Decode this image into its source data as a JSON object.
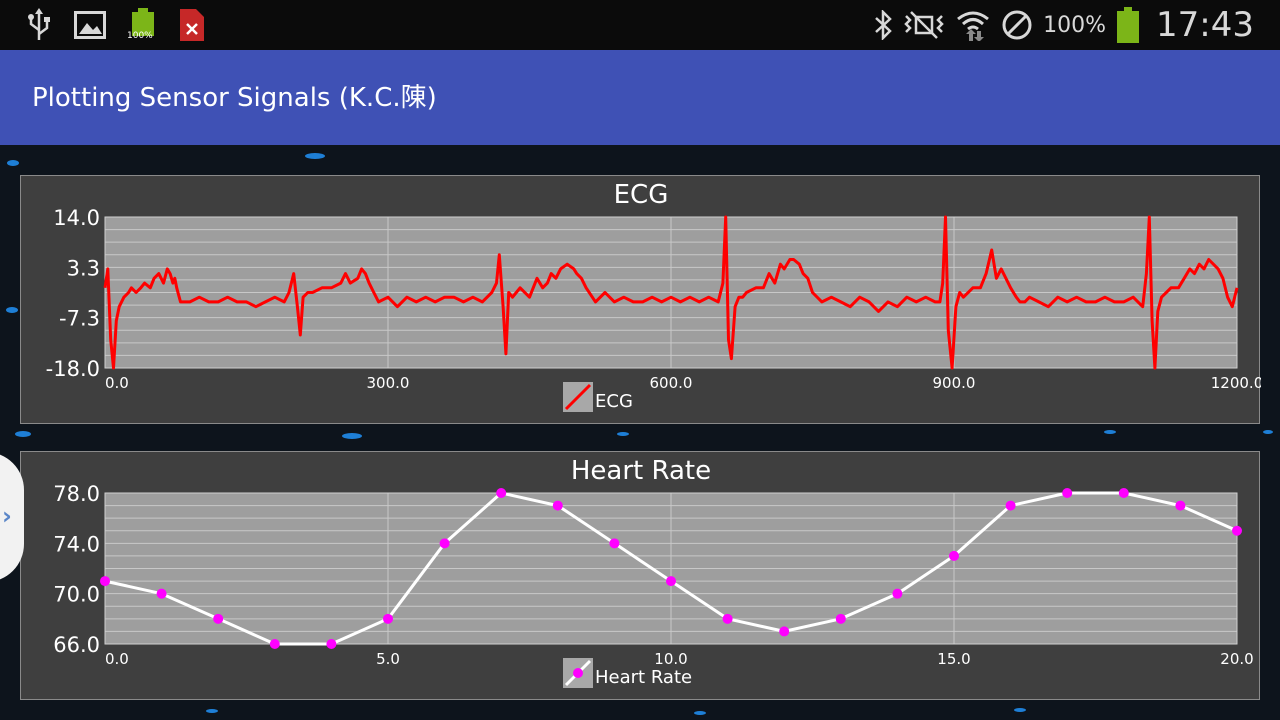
{
  "status_bar": {
    "icons": [
      "usb-icon",
      "image-icon",
      "battery-saver-icon",
      "pdf-error-icon",
      "bluetooth-icon",
      "mute-icon",
      "wifi-icon",
      "blocked-icon",
      "battery-icon"
    ],
    "small_battery_label": "100%",
    "battery_percent": "100%",
    "time": "17:43"
  },
  "app_bar": {
    "title": "Plotting Sensor Signals (K.C.陳)"
  },
  "side_handle": {
    "icon": "chevron-right-icon",
    "glyph": "›"
  },
  "colors": {
    "app_bar": "#3f51b5",
    "plot_bg": "#9e9e9e",
    "ecg_line": "#ff0000",
    "hr_line": "#ffffff",
    "hr_points": "#ff00ff"
  },
  "chart_data": [
    {
      "type": "line",
      "title": "ECG",
      "y_ticks": [
        "14.0",
        "3.3",
        "-7.3",
        "-18.0"
      ],
      "x_ticks": [
        "0.0",
        "300.0",
        "600.0",
        "900.0",
        "1200.0"
      ],
      "xlim": [
        0,
        1200
      ],
      "ylim": [
        -18,
        14
      ],
      "grid": true,
      "legend_position": "bottom",
      "legend_label": "ECG",
      "series": [
        {
          "name": "ECG",
          "x": [
            0,
            3,
            6,
            9,
            12,
            15,
            20,
            25,
            28,
            33,
            38,
            42,
            48,
            52,
            57,
            62,
            66,
            69,
            72,
            74,
            76,
            80,
            90,
            100,
            110,
            120,
            130,
            140,
            150,
            160,
            170,
            180,
            190,
            195,
            200,
            204,
            207,
            210,
            215,
            220,
            230,
            240,
            250,
            255,
            260,
            268,
            272,
            276,
            280,
            285,
            290,
            300,
            310,
            320,
            330,
            340,
            350,
            360,
            370,
            380,
            390,
            400,
            410,
            415,
            418,
            422,
            425,
            428,
            432,
            436,
            440,
            450,
            458,
            464,
            469,
            473,
            478,
            483,
            490,
            497,
            500,
            505,
            510,
            520,
            530,
            540,
            550,
            560,
            570,
            580,
            590,
            600,
            610,
            620,
            630,
            640,
            650,
            655,
            658,
            661,
            664,
            668,
            672,
            676,
            680,
            690,
            698,
            704,
            710,
            716,
            720,
            726,
            730,
            736,
            740,
            745,
            750,
            760,
            770,
            780,
            790,
            800,
            810,
            820,
            830,
            840,
            850,
            860,
            870,
            880,
            885,
            888,
            891,
            894,
            898,
            902,
            906,
            910,
            920,
            928,
            934,
            940,
            945,
            950,
            955,
            960,
            966,
            970,
            975,
            980,
            990,
            1000,
            1010,
            1020,
            1030,
            1040,
            1050,
            1060,
            1070,
            1080,
            1090,
            1100,
            1104,
            1107,
            1110,
            1113,
            1116,
            1120,
            1125,
            1130,
            1138,
            1144,
            1150,
            1155,
            1160,
            1165,
            1170,
            1175,
            1180,
            1185,
            1190,
            1195,
            1200
          ],
          "y": [
            -1,
            3,
            -12,
            -18,
            -8,
            -5,
            -3,
            -2,
            -1,
            -2,
            -1,
            0,
            -1,
            1,
            2,
            0,
            3,
            2,
            0,
            1,
            -1,
            -4,
            -4,
            -3,
            -4,
            -4,
            -3,
            -4,
            -4,
            -5,
            -4,
            -3,
            -4,
            -2,
            2,
            -5,
            -11,
            -3,
            -2,
            -2,
            -1,
            -1,
            0,
            2,
            0,
            1,
            3,
            2,
            0,
            -2,
            -4,
            -3,
            -5,
            -3,
            -4,
            -3,
            -4,
            -3,
            -3,
            -4,
            -3,
            -4,
            -2,
            0,
            6,
            -5,
            -15,
            -2,
            -3,
            -2,
            -1,
            -3,
            1,
            -1,
            0,
            2,
            1,
            3,
            4,
            3,
            2,
            1,
            -1,
            -4,
            -2,
            -4,
            -3,
            -4,
            -4,
            -3,
            -4,
            -3,
            -4,
            -3,
            -4,
            -3,
            -4,
            0,
            14,
            -12,
            -16,
            -5,
            -3,
            -3,
            -2,
            -1,
            -1,
            2,
            0,
            4,
            3,
            5,
            5,
            4,
            2,
            1,
            -2,
            -4,
            -3,
            -4,
            -5,
            -3,
            -4,
            -6,
            -4,
            -5,
            -3,
            -4,
            -3,
            -4,
            -4,
            0,
            14,
            -10,
            -18,
            -5,
            -2,
            -3,
            -1,
            -1,
            2,
            7,
            1,
            3,
            1,
            -1,
            -3,
            -4,
            -4,
            -3,
            -4,
            -5,
            -3,
            -4,
            -3,
            -4,
            -4,
            -3,
            -4,
            -4,
            -3,
            -5,
            2,
            14,
            -8,
            -18,
            -6,
            -3,
            -2,
            -1,
            -1,
            1,
            3,
            2,
            4,
            3,
            5,
            4,
            3,
            1,
            -3,
            -5,
            -1
          ]
        }
      ]
    },
    {
      "type": "line",
      "title": "Heart Rate",
      "y_ticks": [
        "78.0",
        "74.0",
        "70.0",
        "66.0"
      ],
      "x_ticks": [
        "0.0",
        "5.0",
        "10.0",
        "15.0",
        "20.0"
      ],
      "xlim": [
        0,
        20
      ],
      "ylim": [
        66,
        78
      ],
      "grid": true,
      "legend_position": "bottom",
      "legend_label": "Heart Rate",
      "series": [
        {
          "name": "Heart Rate",
          "x": [
            0,
            1,
            2,
            3,
            4,
            5,
            6,
            7,
            8,
            9,
            10,
            11,
            12,
            13,
            14,
            15,
            16,
            17,
            18,
            19,
            20
          ],
          "y": [
            71,
            70,
            68,
            66,
            66,
            68,
            74,
            78,
            77,
            74,
            71,
            68,
            67,
            68,
            70,
            73,
            77,
            78,
            78,
            77,
            75
          ]
        }
      ]
    }
  ]
}
